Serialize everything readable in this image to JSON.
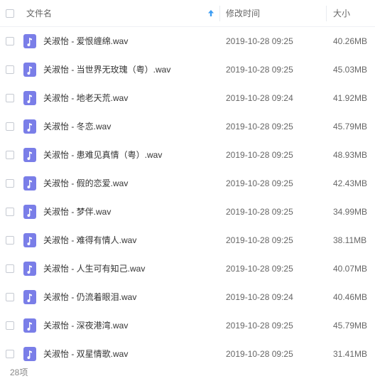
{
  "header": {
    "name_label": "文件名",
    "date_label": "修改时间",
    "size_label": "大小",
    "sort_icon": "arrow-up-icon"
  },
  "colors": {
    "file_icon": "#7a7ee8",
    "sort_arrow": "#3b9cf3"
  },
  "files": [
    {
      "name": "关淑怡 - 爱恨缠绵.wav",
      "modified": "2019-10-28 09:25",
      "size": "40.26MB",
      "icon": "music-file-icon"
    },
    {
      "name": "关淑怡 - 当世界无玫瑰（粤）.wav",
      "modified": "2019-10-28 09:25",
      "size": "45.03MB",
      "icon": "music-file-icon"
    },
    {
      "name": "关淑怡 - 地老天荒.wav",
      "modified": "2019-10-28 09:24",
      "size": "41.92MB",
      "icon": "music-file-icon"
    },
    {
      "name": "关淑怡 - 冬恋.wav",
      "modified": "2019-10-28 09:25",
      "size": "45.79MB",
      "icon": "music-file-icon"
    },
    {
      "name": "关淑怡 - 患难见真情（粤）.wav",
      "modified": "2019-10-28 09:25",
      "size": "48.93MB",
      "icon": "music-file-icon"
    },
    {
      "name": "关淑怡 - 假的恋爱.wav",
      "modified": "2019-10-28 09:25",
      "size": "42.43MB",
      "icon": "music-file-icon"
    },
    {
      "name": "关淑怡 - 梦伴.wav",
      "modified": "2019-10-28 09:25",
      "size": "34.99MB",
      "icon": "music-file-icon"
    },
    {
      "name": "关淑怡 - 难得有情人.wav",
      "modified": "2019-10-28 09:25",
      "size": "38.11MB",
      "icon": "music-file-icon"
    },
    {
      "name": "关淑怡 - 人生可有知己.wav",
      "modified": "2019-10-28 09:25",
      "size": "40.07MB",
      "icon": "music-file-icon"
    },
    {
      "name": "关淑怡 - 仍流着眼泪.wav",
      "modified": "2019-10-28 09:24",
      "size": "40.46MB",
      "icon": "music-file-icon"
    },
    {
      "name": "关淑怡 - 深夜港湾.wav",
      "modified": "2019-10-28 09:25",
      "size": "45.79MB",
      "icon": "music-file-icon"
    },
    {
      "name": "关淑怡 - 双星情歌.wav",
      "modified": "2019-10-28 09:25",
      "size": "31.41MB",
      "icon": "music-file-icon"
    }
  ],
  "footer": {
    "count_label": "28项"
  }
}
